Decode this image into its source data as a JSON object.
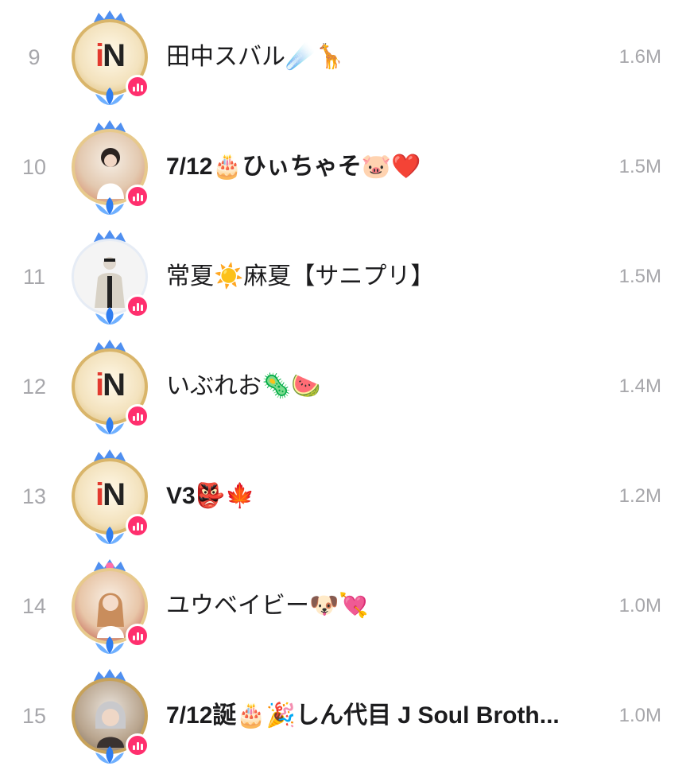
{
  "leaderboard": {
    "rows": [
      {
        "rank": "9",
        "name": "田中スバル☄️🦒",
        "score": "1.6M",
        "avatar": "in-logo-frame"
      },
      {
        "rank": "10",
        "name": "7/12🎂ひぃちゃそ🐷❤️",
        "score": "1.5M",
        "avatar": "photo-frame"
      },
      {
        "rank": "11",
        "name": "常夏☀️麻夏【サニプリ】",
        "score": "1.5M",
        "avatar": "plain-photo"
      },
      {
        "rank": "12",
        "name": "いぶれお🦠🍉",
        "score": "1.4M",
        "avatar": "in-logo-frame"
      },
      {
        "rank": "13",
        "name": "V3👺🍁",
        "score": "1.2M",
        "avatar": "in-logo-frame"
      },
      {
        "rank": "14",
        "name": "ユウベイビー🐶💘",
        "score": "1.0M",
        "avatar": "photo-frame"
      },
      {
        "rank": "15",
        "name": "7/12誕🎂🎉しん代目 J Soul Broth...",
        "score": "1.0M",
        "avatar": "photo-frame"
      }
    ]
  },
  "colors": {
    "rank_text": "#a7a7ab",
    "name_text": "#1c1c1e",
    "score_text": "#a7a7ab",
    "live_badge": "#ff2f6e",
    "frame_gold": "#d9b56a",
    "crown_blue": "#4f8ff0"
  },
  "icons": {
    "crown": "crown-icon",
    "lotus": "lotus-icon",
    "live": "live-bars-icon"
  },
  "avatar_logo": {
    "prefix": "i",
    "suffix": "N"
  }
}
